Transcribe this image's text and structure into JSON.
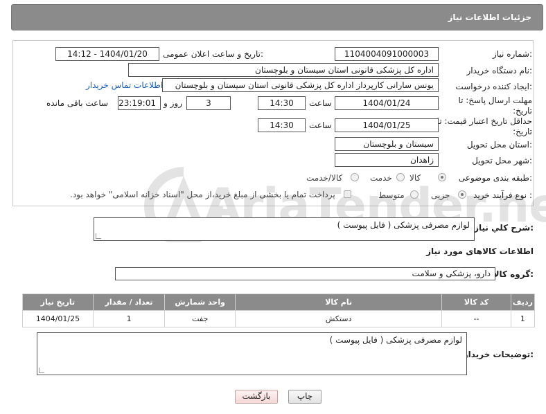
{
  "header": {
    "title": "جزئیات اطلاعات نیاز"
  },
  "form": {
    "need_number_label": "شماره نیاز:",
    "need_number": "1104004091000003",
    "announce_label": "تاریخ و ساعت اعلان عمومی:",
    "announce_value": "1404/01/20 - 14:12",
    "buyer_org_label": "نام دستگاه خریدار:",
    "buyer_org": "اداره کل پزشکی قانونی استان سیستان و بلوچستان",
    "creator_label": "ایجاد کننده درخواست:",
    "creator": "یونس سارانی کارپرداز اداره کل پزشکی قانونی استان سیستان و بلوچستان",
    "contact_link": "اطلاعات تماس خریدار",
    "deadline_label": "مهلت ارسال پاسخ: تا تاریخ:",
    "deadline_date": "1404/01/24",
    "time_label": "ساعت",
    "deadline_time": "14:30",
    "days_value": "3",
    "days_label": "روز و",
    "remaining_value": "23:19:01",
    "remaining_label": "ساعت باقی مانده",
    "validity_label": "حداقل تاریخ اعتبار قیمت: تا تاریخ:",
    "validity_date": "1404/01/25",
    "validity_time": "14:30",
    "province_label": "استان محل تحویل:",
    "province": "سیستان و بلوچستان",
    "city_label": "شهر محل تحویل:",
    "city": "زاهدان",
    "category_label": "طبقه بندی موضوعی:",
    "category_options": [
      "کالا",
      "خدمت",
      "کالا/خدمت"
    ],
    "process_label": "نوع فرآیند خرید :",
    "process_options": [
      "جزیی",
      "متوسط"
    ],
    "payment_note": "پرداخت تمام یا بخشی از مبلغ خرید،از محل \"اسناد خزانه اسلامی\" خواهد بود."
  },
  "description": {
    "label": "شرح کلي نياز:",
    "value": "لوازم مصرفی پزشکی ( فایل پیوست )"
  },
  "goods_info": {
    "title": "اطلاعات کالاهای مورد نیاز",
    "group_label": "گروه کالا:",
    "group_value": "دارو، پزشکی و سلامت"
  },
  "table": {
    "headers": [
      "ردیف",
      "کد کالا",
      "نام کالا",
      "واحد شمارش",
      "تعداد / مقدار",
      "تاریخ نیاز"
    ],
    "rows": [
      [
        "1",
        "--",
        "دستکش",
        "جفت",
        "1",
        "1404/01/25"
      ]
    ]
  },
  "buyer_notes": {
    "label": "توضیحات خریدار:",
    "value": "لوازم مصرفی پزشکی ( فایل پیوست )"
  },
  "buttons": {
    "print": "چاپ",
    "back": "بازگشت"
  },
  "watermark": {
    "text": "AriaTender.net"
  }
}
